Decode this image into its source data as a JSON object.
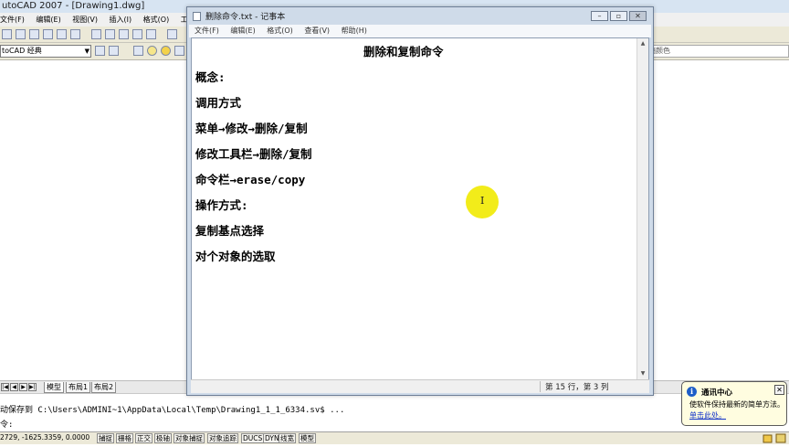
{
  "acad": {
    "title": "utoCAD 2007 - [Drawing1.dwg]",
    "menu": [
      "文件(F)",
      "编辑(E)",
      "视图(V)",
      "插入(I)",
      "格式(O)",
      "工具(T)"
    ],
    "workspace": "toCAD 经典",
    "color_label": "随颜色",
    "layout_tabs": [
      "模型",
      "布局1",
      "布局2"
    ],
    "command_history": "动保存到 C:\\Users\\ADMINI~1\\AppData\\Local\\Temp\\Drawing1_1_1_6334.sv$ ...",
    "command_prompt": "令:",
    "coords": "2729,  -1625.3359, 0.0000",
    "status_buttons": [
      "捕捉",
      "栅格",
      "正交",
      "极轴",
      "对象捕捉",
      "对象追踪",
      "DUCS",
      "DYN",
      "线宽",
      "模型"
    ]
  },
  "notepad": {
    "title": "删除命令.txt - 记事本",
    "menu": [
      "文件(F)",
      "编辑(E)",
      "格式(O)",
      "查看(V)",
      "帮助(H)"
    ],
    "heading": "删除和复制命令",
    "lines": [
      "概念:",
      "调用方式",
      "菜单→修改→删除/复制",
      "修改工具栏→删除/复制",
      "命令栏→erase/copy",
      "操作方式:",
      "复制基点选择",
      "对个对象的选取"
    ],
    "status": "第 15 行，第 3 列"
  },
  "balloon": {
    "title": "通讯中心",
    "body": "使软件保持最新的简单方法。",
    "link": "单击此处。"
  },
  "colors": {
    "cursor_highlight": "#f2ec1a",
    "link": "#1233c8",
    "info_icon": "#1e5ec8"
  }
}
